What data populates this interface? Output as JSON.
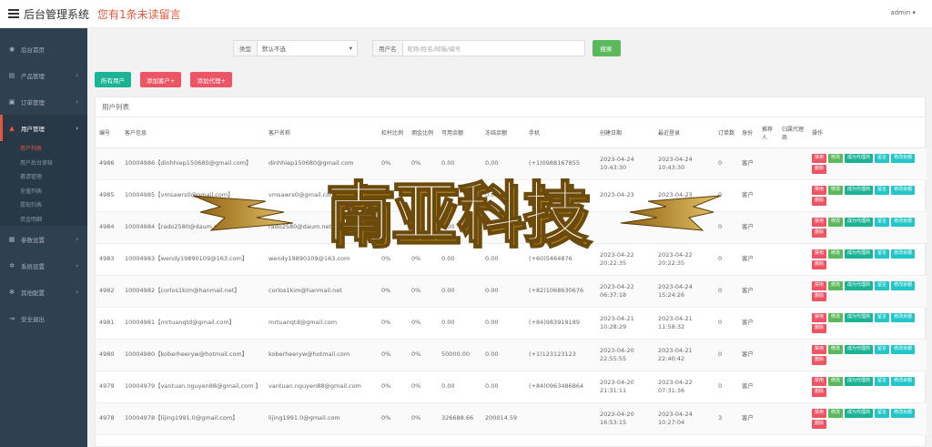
{
  "header": {
    "title": "后台管理系统",
    "unread_notice": "您有1条未读留言",
    "user": "admin"
  },
  "sidebar": {
    "items": [
      {
        "label": "后台首页",
        "icon": "dashboard-icon"
      },
      {
        "label": "产品管理",
        "icon": "product-icon"
      },
      {
        "label": "订单管理",
        "icon": "order-icon"
      },
      {
        "label": "用户管理",
        "icon": "user-icon"
      },
      {
        "label": "参数设置",
        "icon": "params-icon"
      },
      {
        "label": "系统设置",
        "icon": "gear-icon"
      },
      {
        "label": "其他配置",
        "icon": "cog-icon"
      },
      {
        "label": "安全退出",
        "icon": "logout-icon"
      }
    ],
    "subitems": [
      "用户列表",
      "用户后台审核",
      "邀请管理",
      "充值列表",
      "提现列表",
      "资金明细"
    ]
  },
  "filters": {
    "type_label": "类型",
    "type_value": "默认不选",
    "user_label": "用户名",
    "user_placeholder": "昵称/姓名/邮箱/编号",
    "search_label": "搜索"
  },
  "actions": {
    "all_users": "所有用户",
    "add_customer": "添加客户+",
    "add_agent": "添加代理+"
  },
  "table": {
    "title": "用户列表",
    "headers": [
      "编号",
      "客户信息",
      "客户名称",
      "杠杆比例",
      "佣金比例",
      "可用余额",
      "冻结余额",
      "手机",
      "创建日期",
      "最近登录",
      "订单数",
      "身份",
      "推荐人",
      "归属代理商",
      "操作"
    ],
    "row_buttons": [
      "禁用",
      "修改",
      "成为代理商",
      "留言",
      "修改余额",
      "删除"
    ],
    "rows": [
      {
        "id": "4986",
        "info": "10004986【dinhhiep150680@gmail.com】",
        "name": "dinhhiep150680@gmail.com",
        "leverage": "0%",
        "commission": "0%",
        "balance": "0.00",
        "frozen": "0.00",
        "phone": "(+1)0988167855",
        "created": "2023-04-24 10:43:30",
        "last_login": "2023-04-24 10:43:30",
        "orders": "0",
        "role": "客户"
      },
      {
        "id": "4985",
        "info": "10004985【vmsawrs0@gmail.com】",
        "name": "vmsawrs0@gmail.com",
        "leverage": "0%",
        "commission": "0%",
        "balance": "0.00",
        "frozen": "0.00",
        "phone": "(+1)3056430760",
        "created": "2023-04-23",
        "last_login": "2023-04-23",
        "orders": "0",
        "role": "客户"
      },
      {
        "id": "4984",
        "info": "10004984【rado2580@daum.net】",
        "name": "rado2580@daum.net",
        "leverage": "0%",
        "commission": "0%",
        "balance": "0.00",
        "frozen": "0.00",
        "phone": "",
        "created": "",
        "last_login": "",
        "orders": "0",
        "role": "客户"
      },
      {
        "id": "4983",
        "info": "10004983【wendy19890109@163.com】",
        "name": "wendy19890109@163.com",
        "leverage": "0%",
        "commission": "0%",
        "balance": "0.00",
        "frozen": "0.00",
        "phone": "(+60)5464876",
        "created": "2023-04-22 20:22:35",
        "last_login": "2023-04-22 20:22:35",
        "orders": "0",
        "role": "客户"
      },
      {
        "id": "4982",
        "info": "10004982【corlos1kim@hanmail.net】",
        "name": "corlos1kim@hanmail.net",
        "leverage": "0%",
        "commission": "0%",
        "balance": "0.00",
        "frozen": "0.00",
        "phone": "(+82)1068630676",
        "created": "2023-04-22 06:37:18",
        "last_login": "2023-04-24 15:24:26",
        "orders": "0",
        "role": "客户"
      },
      {
        "id": "4981",
        "info": "10004981【mrtuanqtd@gmail.com】",
        "name": "mrtuanqtd@gmail.com",
        "leverage": "0%",
        "commission": "0%",
        "balance": "0.00",
        "frozen": "0.00",
        "phone": "(+84)983919189",
        "created": "2023-04-21 10:28:29",
        "last_login": "2023-04-21 11:58:32",
        "orders": "0",
        "role": "客户"
      },
      {
        "id": "4980",
        "info": "10004980【koberheeryw@hotmail.com】",
        "name": "koberheeryw@hotmail.com",
        "leverage": "0%",
        "commission": "0%",
        "balance": "50000.00",
        "frozen": "0.00",
        "phone": "(+1)123123123",
        "created": "2023-04-20 22:55:55",
        "last_login": "2023-04-21 22:40:42",
        "orders": "0",
        "role": "客户"
      },
      {
        "id": "4979",
        "info": "10004979【vantuan.nguyen88@gmail.com 】",
        "name": "vantuan.nguyen88@gmail.com",
        "leverage": "0%",
        "commission": "0%",
        "balance": "0.00",
        "frozen": "0.00",
        "phone": "(+84)0963486864",
        "created": "2023-04-20 21:31:11",
        "last_login": "2023-04-22 07:31:36",
        "orders": "0",
        "role": "客户"
      },
      {
        "id": "4978",
        "info": "10004978【lijing1991.0@gmail.com】",
        "name": "lijing1991.0@gmail.com",
        "leverage": "0%",
        "commission": "0%",
        "balance": "326688.66",
        "frozen": "200014.59",
        "phone": "",
        "created": "2023-04-20 16:53:15",
        "last_login": "2023-04-24 10:27:04",
        "orders": "3",
        "role": "客户"
      }
    ]
  },
  "watermark": {
    "text": "南亚科技",
    "colors": {
      "face": "#f5f0e6",
      "side": "#b58a1e",
      "outline": "#6b4a0c"
    }
  }
}
